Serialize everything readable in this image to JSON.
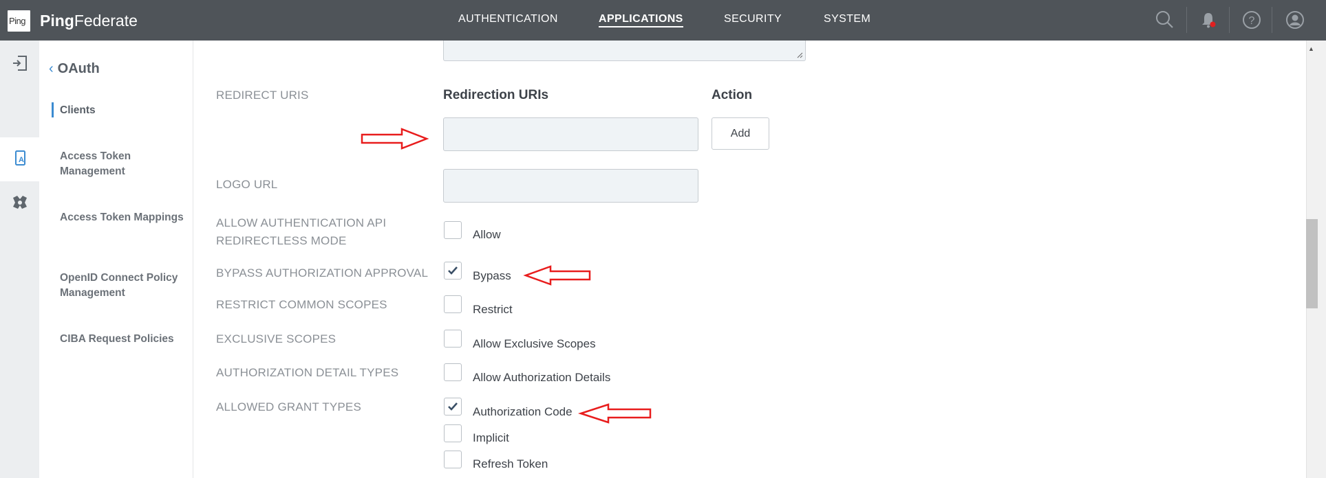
{
  "topbar": {
    "logo_small": "Ping",
    "brand_bold": "Ping",
    "brand_rest": "Federate",
    "nav": [
      {
        "label": "AUTHENTICATION",
        "active": false
      },
      {
        "label": "APPLICATIONS",
        "active": true
      },
      {
        "label": "SECURITY",
        "active": false
      },
      {
        "label": "SYSTEM",
        "active": false
      }
    ],
    "icons": [
      "search-icon",
      "bell-icon",
      "help-icon",
      "user-icon"
    ],
    "notification_color": "#e02020"
  },
  "rail": {
    "items": [
      {
        "icon": "login-icon",
        "active": false
      },
      {
        "icon": "oauth-app-icon",
        "active": true
      },
      {
        "icon": "integration-icon",
        "active": false
      }
    ]
  },
  "sidebar": {
    "back_label": "OAuth",
    "items": [
      {
        "label": "Clients",
        "active": true
      },
      {
        "label": "Access Token Management",
        "active": false
      },
      {
        "label": "Access Token Mappings",
        "active": false
      },
      {
        "label": "OpenID Connect Policy Management",
        "active": false
      },
      {
        "label": "CIBA Request Policies",
        "active": false
      }
    ]
  },
  "form": {
    "redirect_uris": {
      "label": "REDIRECT URIS",
      "col_uris": "Redirection URIs",
      "col_action": "Action",
      "input_value": "",
      "add_button": "Add"
    },
    "logo_url": {
      "label": "LOGO URL",
      "value": ""
    },
    "redirectless": {
      "label_line1": "ALLOW AUTHENTICATION API",
      "label_line2": "REDIRECTLESS MODE",
      "option": "Allow",
      "checked": false
    },
    "bypass": {
      "label": "BYPASS AUTHORIZATION APPROVAL",
      "option": "Bypass",
      "checked": true
    },
    "restrict": {
      "label": "RESTRICT COMMON SCOPES",
      "option": "Restrict",
      "checked": false
    },
    "exclusive": {
      "label": "EXCLUSIVE SCOPES",
      "option": "Allow Exclusive Scopes",
      "checked": false
    },
    "detail_types": {
      "label": "AUTHORIZATION DETAIL TYPES",
      "option": "Allow Authorization Details",
      "checked": false
    },
    "grant_types": {
      "label": "ALLOWED GRANT TYPES",
      "options": [
        {
          "label": "Authorization Code",
          "checked": true
        },
        {
          "label": "Implicit",
          "checked": false
        },
        {
          "label": "Refresh Token",
          "checked": false
        }
      ]
    }
  },
  "colors": {
    "topbar": "#4f5459",
    "accent": "#3b8bd1",
    "annotation_arrow": "#e81c1c"
  }
}
